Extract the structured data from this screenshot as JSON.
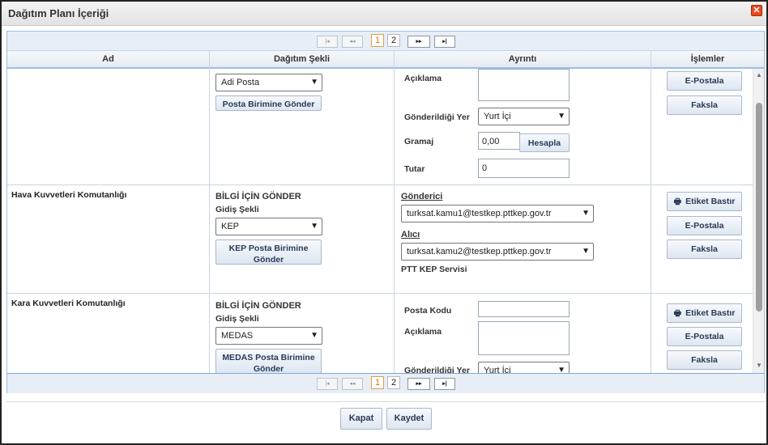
{
  "dialog": {
    "title": "Dağıtım Planı İçeriği",
    "close_glyph": "✕"
  },
  "pager": {
    "first_glyph": "|◂",
    "prev_glyph": "◂◂",
    "next_glyph": "▸▸",
    "last_glyph": "▸|",
    "pages": [
      "1",
      "2"
    ],
    "current": "1"
  },
  "table": {
    "headers": [
      "Ad",
      "Dağıtım Şekli",
      "Ayrıntı",
      "İşlemler"
    ],
    "rows": [
      {
        "name": "",
        "method": "Adi Posta",
        "send_button": "Posta Birimine Gönder",
        "detail": {
          "description_label": "Açıklama",
          "destination_label": "Gönderildiği Yer",
          "destination_value": "Yurt İçi",
          "weight_label": "Gramaj",
          "weight_value": "0,00",
          "calculate_button": "Hesapla",
          "amount_label": "Tutar",
          "amount_value": "0"
        },
        "actions": [
          "E-Postala",
          "Faksla"
        ]
      },
      {
        "name": "Hava Kuvvetleri Komutanlığı",
        "info_heading": "BİLGİ İÇİN GÖNDER",
        "method_label": "Gidiş Şekli",
        "method": "KEP",
        "send_button": "KEP Posta Birimine Gönder",
        "detail": {
          "sender_label": "Gönderici",
          "sender_value": "turksat.kamu1@testkep.pttkep.gov.tr",
          "recipient_label": "Alıcı",
          "recipient_value": "turksat.kamu2@testkep.pttkep.gov.tr",
          "service": "PTT KEP Servisi"
        },
        "actions": [
          "Etiket Bastır",
          "E-Postala",
          "Faksla"
        ]
      },
      {
        "name": "Kara Kuvvetleri Komutanlığı",
        "info_heading": "BİLGİ İÇİN GÖNDER",
        "method_label": "Gidiş Şekli",
        "method": "MEDAS",
        "send_button": "MEDAS Posta Birimine Gönder",
        "detail": {
          "postal_code_label": "Posta Kodu",
          "description_label": "Açıklama",
          "destination_label": "Gönderildiği Yer",
          "destination_value": "Yurt İçi"
        },
        "actions": [
          "Etiket Bastır",
          "E-Postala",
          "Faksla"
        ]
      }
    ]
  },
  "footer": {
    "close_label": "Kapat",
    "save_label": "Kaydet"
  },
  "colors": {
    "border_blue": "#9cc0e4",
    "active_page": "#e07000",
    "close_red": "#e8491d"
  },
  "icons": {
    "printer": "printer-icon",
    "dropdown": "chevron-down-icon",
    "close": "close-icon"
  }
}
